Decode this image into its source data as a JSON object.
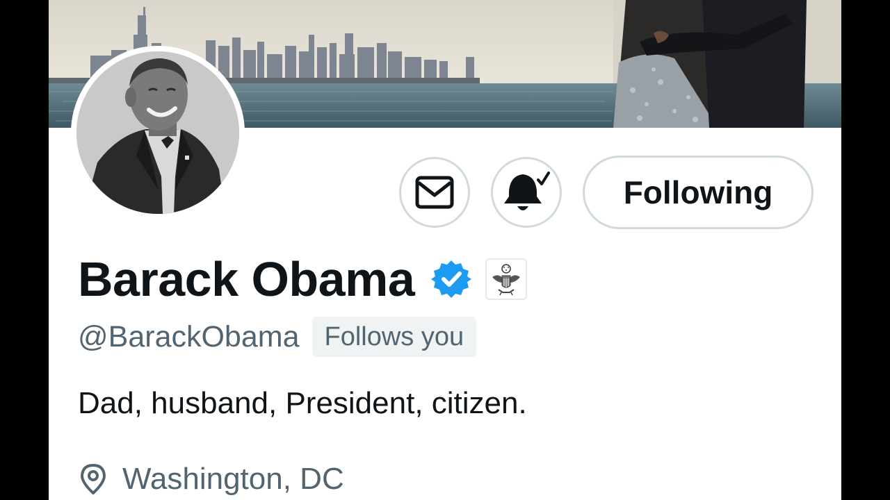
{
  "profile": {
    "display_name": "Barack Obama",
    "handle": "@BarackObama",
    "follows_you": "Follows you",
    "bio": "Dad, husband, President, citizen.",
    "location": "Washington, DC",
    "verified": true
  },
  "actions": {
    "following_label": "Following",
    "message_icon": "envelope-icon",
    "notifications_icon": "bell-check-icon"
  },
  "icons": {
    "verified_badge": "verified-badge-icon",
    "affiliate_badge": "government-seal-icon",
    "location": "location-pin-icon"
  },
  "colors": {
    "text_primary": "#0f1419",
    "text_secondary": "#536471",
    "verified_blue": "#1d9bf0",
    "button_border": "#cfd9de",
    "badge_background": "#eff3f4"
  }
}
